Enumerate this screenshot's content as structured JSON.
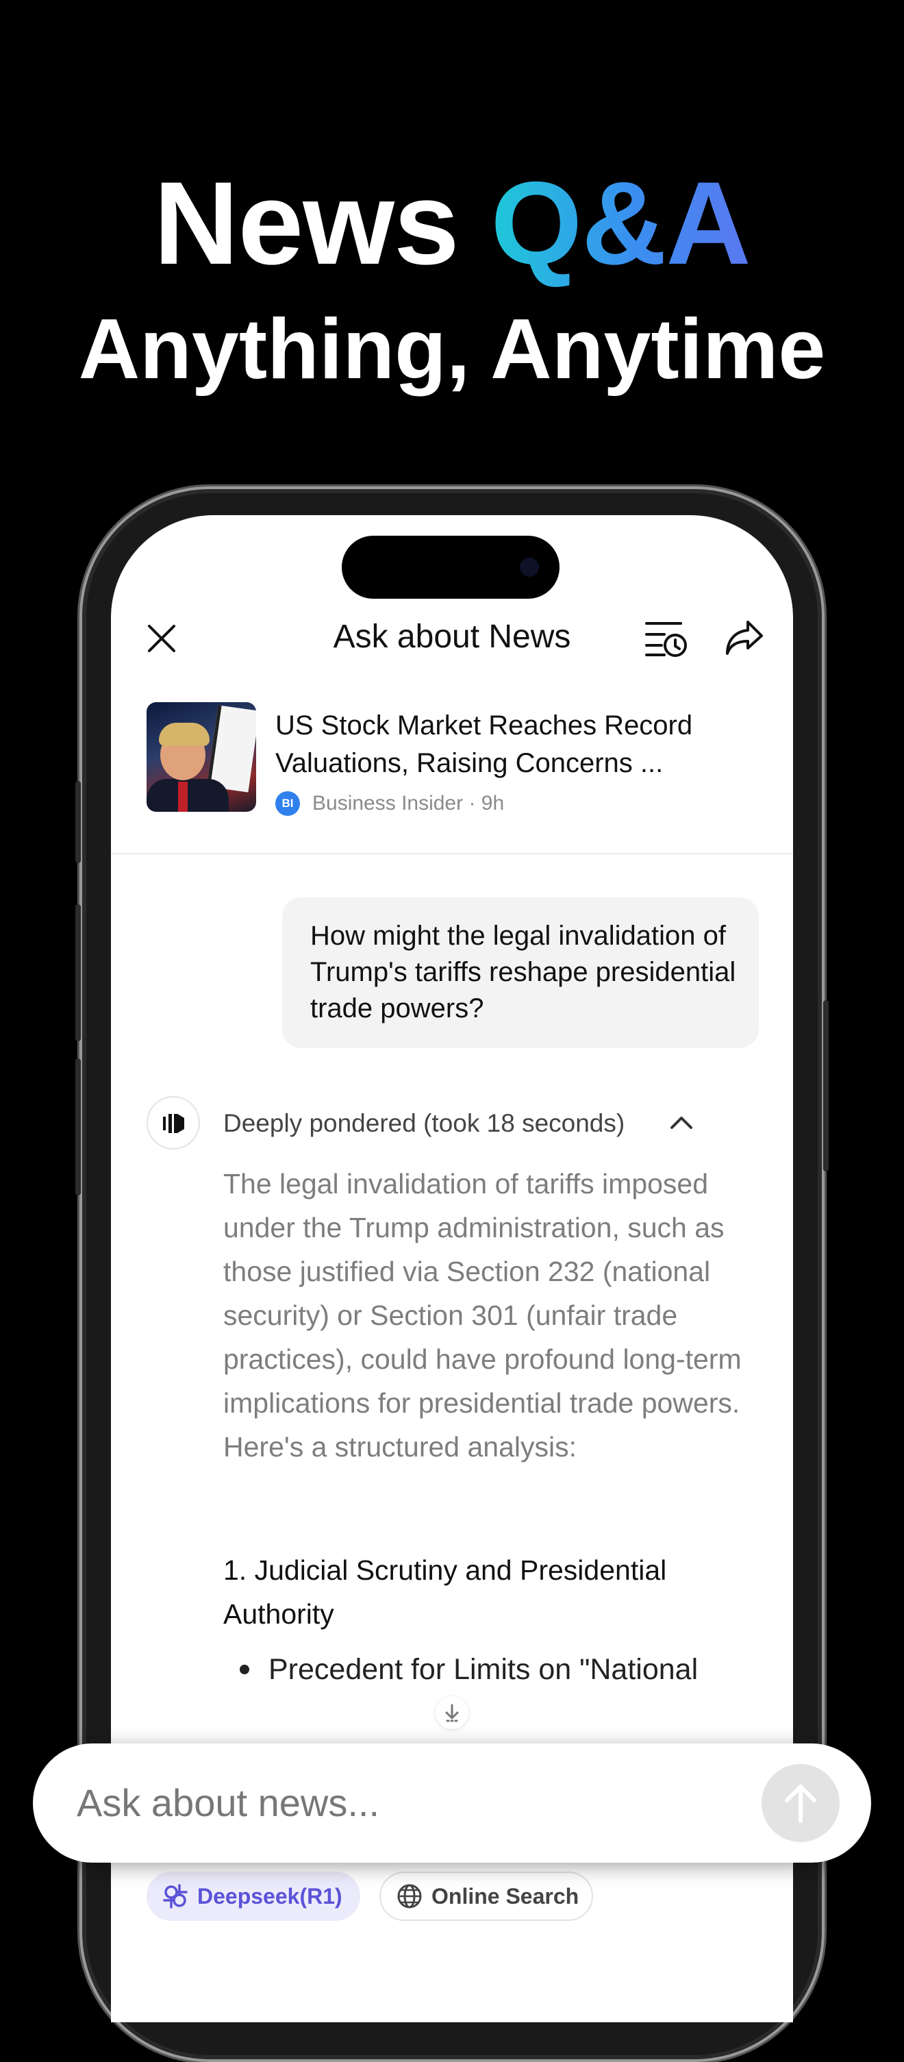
{
  "headline": {
    "word1": "News",
    "accent": "Q&A",
    "subline": "Anything, Anytime"
  },
  "header": {
    "title": "Ask about News",
    "close_icon": "close-icon",
    "history_icon": "history-icon",
    "share_icon": "share-icon"
  },
  "article": {
    "title": "US Stock Market Reaches Record Valuations, Raising Concerns ...",
    "source_logo": "BI",
    "source_line": "Business Insider · 9h"
  },
  "chat": {
    "user_message": "How might the legal invalidation of Trump's tariffs reshape presidential trade powers?",
    "reasoning_label": "Deeply pondered (took 18 seconds)",
    "reasoning_text": "The legal invalidation of tariffs imposed under the Trump administration, such as those justified via Section 232 (national security) or Section 301 (unfair trade practices), could have profound long-term implications for presidential trade powers. Here's a structured analysis:",
    "answer_heading": "1. Judicial Scrutiny and Presidential Authority",
    "bullet": "Precedent for Limits on \"National"
  },
  "input": {
    "placeholder": "Ask about news..."
  },
  "toolbar": {
    "model_chip": "Deepseek(R1)",
    "search_chip": "Online Search"
  },
  "colors": {
    "accent_start": "#1ec8d8",
    "accent_end": "#5a78f0",
    "chip_purple": "#5b53d8",
    "source_blue": "#2f80ed"
  }
}
